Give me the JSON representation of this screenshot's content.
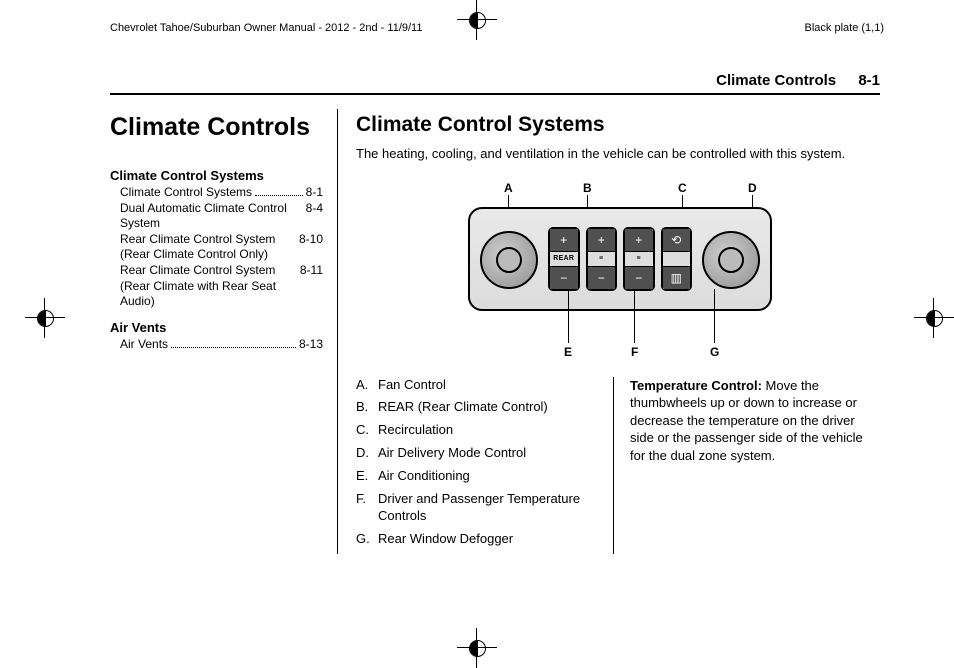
{
  "print": {
    "doc_title": "Chevrolet Tahoe/Suburban Owner Manual - 2012 - 2nd - 11/9/11",
    "plate": "Black plate (1,1)"
  },
  "running_head": {
    "section": "Climate Controls",
    "page": "8-1"
  },
  "chapter_title": "Climate Controls",
  "toc": {
    "group1": {
      "heading": "Climate Control Systems",
      "items": [
        {
          "label": "Climate Control Systems",
          "page": "8-1",
          "indent": 0
        },
        {
          "label": "Dual Automatic Climate Control System",
          "page": "8-4",
          "indent": 0
        },
        {
          "label": "Rear Climate Control System (Rear Climate Control Only)",
          "page": "8-10",
          "indent": 0
        },
        {
          "label": "Rear Climate Control System (Rear Climate with Rear Seat Audio)",
          "page": "8-11",
          "indent": 0
        }
      ]
    },
    "group2": {
      "heading": "Air Vents",
      "items": [
        {
          "label": "Air Vents",
          "page": "8-13",
          "indent": 0
        }
      ]
    }
  },
  "section_title": "Climate Control Systems",
  "intro": "The heating, cooling, and ventilation in the vehicle can be controlled with this system.",
  "figure": {
    "button_label": "REAR",
    "callouts_top": [
      "A",
      "B",
      "C",
      "D"
    ],
    "callouts_bottom": [
      "E",
      "F",
      "G"
    ]
  },
  "legend": [
    {
      "letter": "A.",
      "text": "Fan Control"
    },
    {
      "letter": "B.",
      "text": "REAR (Rear Climate Control)"
    },
    {
      "letter": "C.",
      "text": "Recirculation"
    },
    {
      "letter": "D.",
      "text": "Air Delivery Mode Control"
    },
    {
      "letter": "E.",
      "text": "Air Conditioning"
    },
    {
      "letter": "F.",
      "text": "Driver and Passenger Temperature Controls"
    },
    {
      "letter": "G.",
      "text": "Rear Window Defogger"
    }
  ],
  "paragraph": {
    "bold": "Temperature Control:",
    "body": "  Move the thumbwheels up or down to increase or decrease the temperature on the driver side or the passenger side of the vehicle for the dual zone system."
  }
}
